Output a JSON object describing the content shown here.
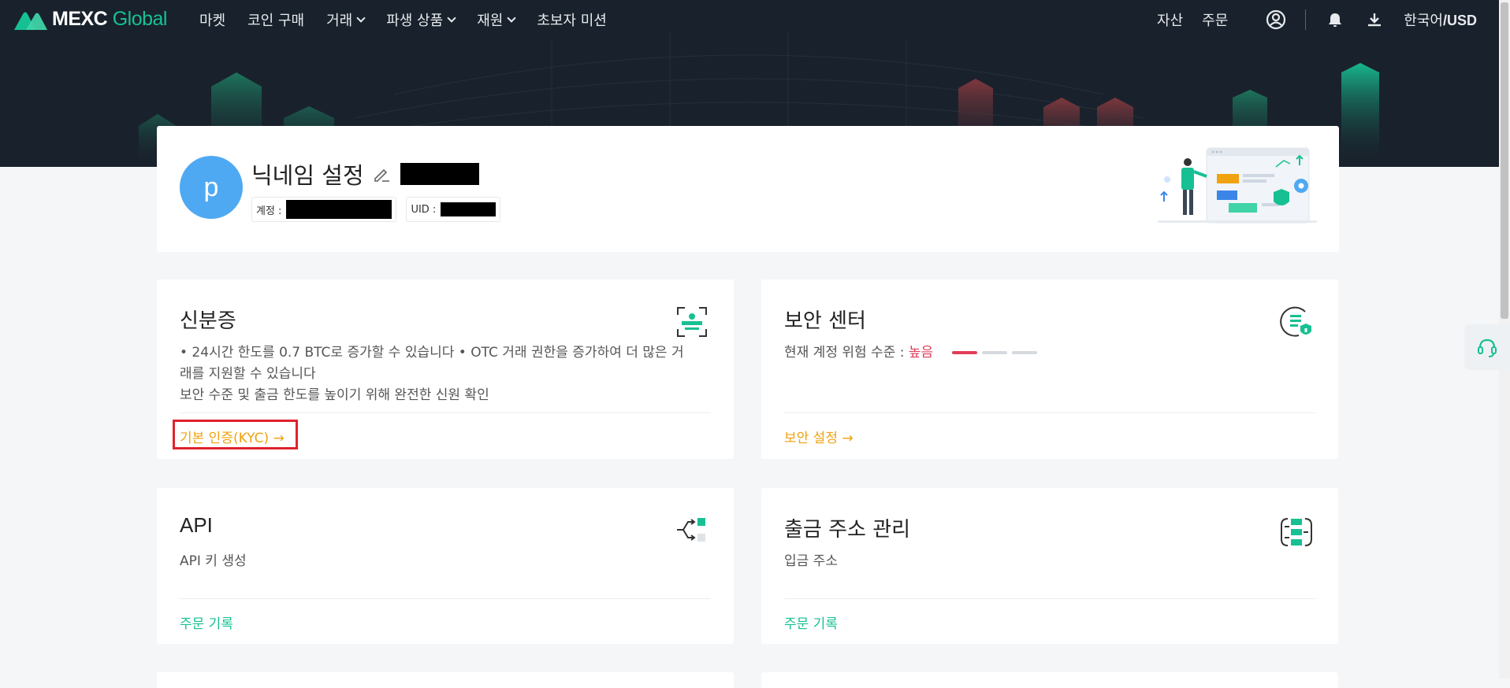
{
  "header": {
    "brand_main": "MEXC",
    "brand_sub": "Global",
    "nav": [
      {
        "label": "마켓",
        "dropdown": false
      },
      {
        "label": "코인 구매",
        "dropdown": false
      },
      {
        "label": "거래",
        "dropdown": true
      },
      {
        "label": "파생 상품",
        "dropdown": true
      },
      {
        "label": "재원",
        "dropdown": true
      },
      {
        "label": "초보자 미션",
        "dropdown": false
      }
    ],
    "assets_label": "자산",
    "orders_label": "주문",
    "language": "한국어",
    "currency": "/USD"
  },
  "profile": {
    "avatar_letter": "p",
    "nickname_label": "닉네임 설정",
    "account_label": "계정 :",
    "uid_label": "UID :"
  },
  "cards": {
    "identity": {
      "title": "신분증",
      "desc_line1": "• 24시간 한도를 0.7 BTC로 증가할 수 있습니다 • OTC 거래 권한을 증가하여 더 많은 거",
      "desc_line2": "래를 지원할 수 있습니다",
      "desc_line3": "보안 수준 및 출금 한도를 높이기 위해 완전한 신원 확인",
      "link": "기본 인증(KYC) →"
    },
    "security": {
      "title": "보안 센터",
      "risk_label": "현재 계정 위험 수준 :",
      "risk_value": "높음",
      "risk_level": 1,
      "risk_max": 3,
      "link": "보안 설정 →"
    },
    "api": {
      "title": "API",
      "desc": "API 키 생성",
      "link": "주문 기록"
    },
    "withdraw": {
      "title": "출금 주소 관리",
      "desc": "입금 주소",
      "link": "주문 기록"
    }
  },
  "colors": {
    "accent_green": "#17c093",
    "link_orange": "#f0a20f",
    "risk_red": "#e03c59",
    "header_bg": "#19222c",
    "avatar_blue": "#4fa9f2",
    "kyc_highlight": "#e0222c"
  },
  "icons": {
    "logo": "mexc-logo-icon",
    "edit": "edit-pencil-icon",
    "user": "user-circle-icon",
    "bell": "bell-icon",
    "download": "download-icon",
    "id": "id-card-icon",
    "security": "shield-list-icon",
    "api": "api-branch-icon",
    "withdraw": "address-book-icon",
    "support": "headset-icon"
  }
}
